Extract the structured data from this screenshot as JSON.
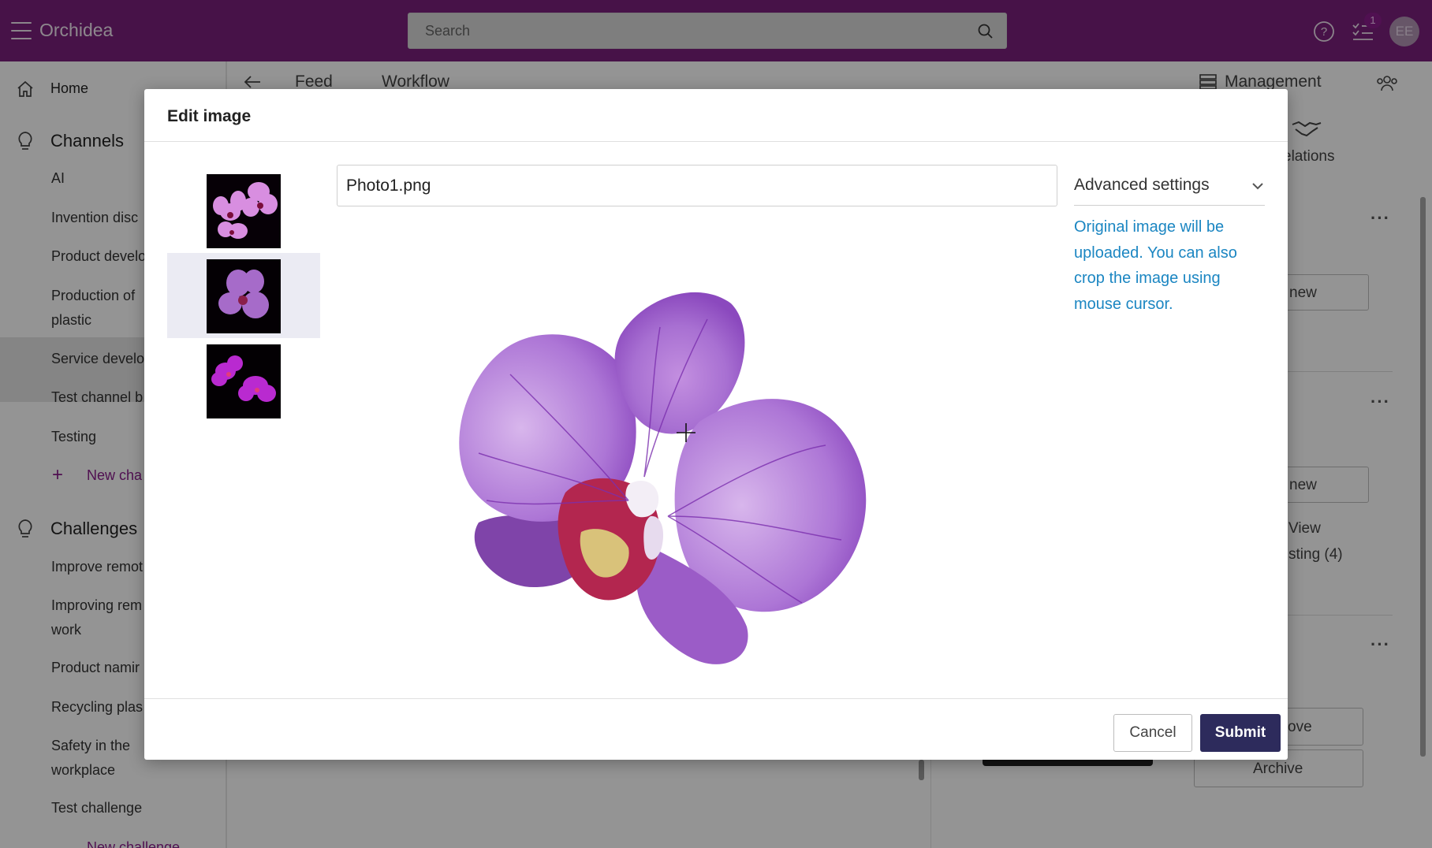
{
  "header": {
    "brand": "Orchidea",
    "search_placeholder": "Search",
    "notification_count": "1",
    "avatar_initials": "EE"
  },
  "sidebar": {
    "home": "Home",
    "channels_heading": "Channels",
    "channels": [
      "AI",
      "Invention disc",
      "Product develo",
      "Production of plastic",
      "Service develo",
      "Test channel b",
      "Testing"
    ],
    "new_channel": "New cha",
    "challenges_heading": "Challenges",
    "challenges": [
      "Improve remot",
      "Improving rem work",
      "Product namir",
      "Recycling plas",
      "Safety in the workplace",
      "Test challenge"
    ],
    "new_challenge": "New challenge"
  },
  "background": {
    "tabs": [
      "Feed",
      "Workflow"
    ],
    "management": "Management",
    "relations": "elations",
    "new_button_1": "new",
    "new_button_2": "new",
    "view": "View",
    "listing": "sting (4)",
    "approve": "ove",
    "archive": "Archive"
  },
  "modal": {
    "title": "Edit image",
    "filename": "Photo1.png",
    "advanced_settings": "Advanced settings",
    "info_text": "Original image will be uploaded. You can also crop the image using mouse cursor.",
    "cancel": "Cancel",
    "submit": "Submit",
    "selected_thumbnail_index": 1
  },
  "colors": {
    "topbar": "#7a1f7c",
    "submit": "#2d2b5c",
    "info_text": "#1b86c2",
    "accent": "#8a1d8c"
  }
}
